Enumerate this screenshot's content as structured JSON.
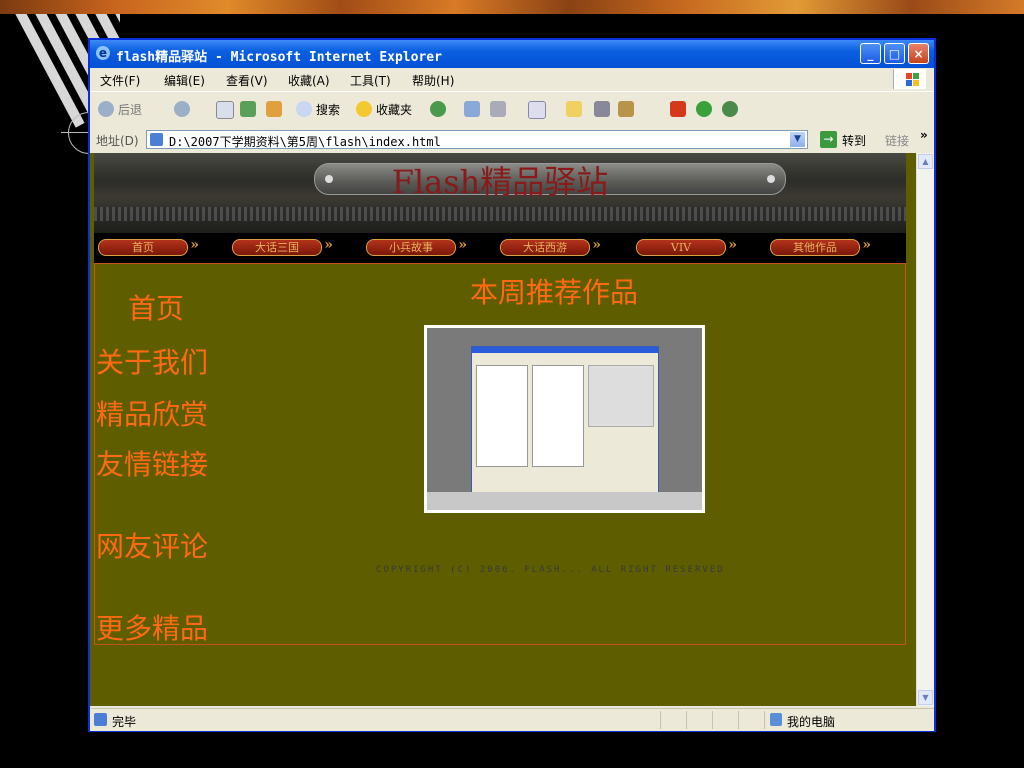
{
  "window": {
    "title": "flash精品驿站 - Microsoft Internet Explorer"
  },
  "menu": [
    "文件(F)",
    "编辑(E)",
    "查看(V)",
    "收藏(A)",
    "工具(T)",
    "帮助(H)"
  ],
  "toolbar": {
    "back": "后退",
    "search": "搜索",
    "favorites": "收藏夹"
  },
  "address": {
    "label": "地址(D)",
    "url": "D:\\2007下学期资料\\第5周\\flash\\index.html",
    "go": "转到",
    "links": "链接",
    "more": "»"
  },
  "page": {
    "banner_title": "Flash精品驿站",
    "nav": [
      "首页",
      "大话三国",
      "小兵故事",
      "大话西游",
      "VIV",
      "其他作品"
    ],
    "side_links": [
      "首页",
      "关于我们",
      "精品欣赏",
      "友情链接",
      "网友评论",
      "更多精品"
    ],
    "featured_title": "本周推荐作品",
    "copyright": "COPYRIGHT (C) 2006. FLASH... ALL RIGHT RESERVED"
  },
  "status": {
    "text": "完毕",
    "zone": "我的电脑"
  },
  "colors": {
    "page_bg": "#5e5e00",
    "link_color": "#ff6a10",
    "titlebar": "#0a5fe0"
  }
}
